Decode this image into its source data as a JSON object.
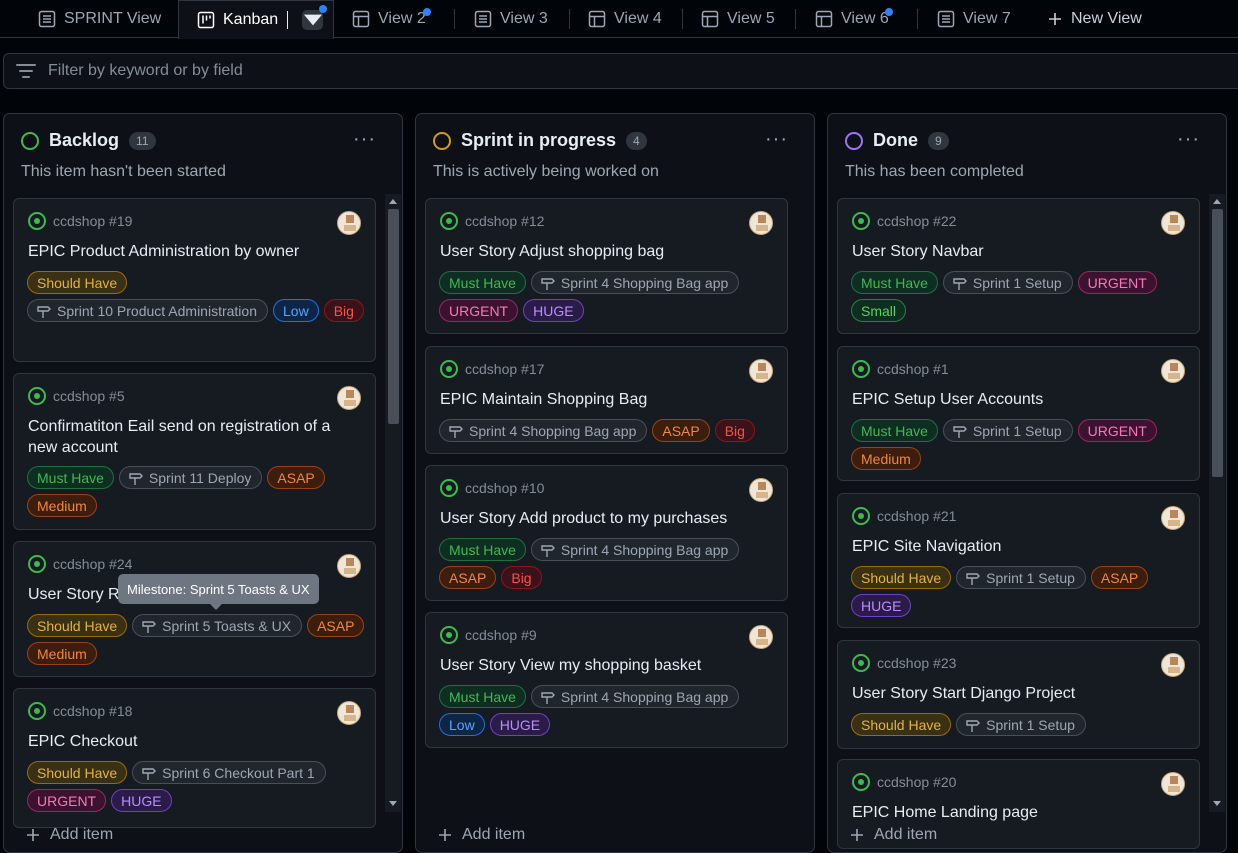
{
  "tabs": [
    {
      "label": "SPRINT View",
      "icon": "table-icon",
      "dot": false
    },
    {
      "label": "Kanban",
      "icon": "board-icon",
      "dot": true
    },
    {
      "label": "View 2",
      "icon": "table-icon",
      "dot": true
    },
    {
      "label": "View 3",
      "icon": "table-icon",
      "dot": false
    },
    {
      "label": "View 4",
      "icon": "table-icon",
      "dot": false
    },
    {
      "label": "View 5",
      "icon": "table-icon",
      "dot": false
    },
    {
      "label": "View 6",
      "icon": "table-icon",
      "dot": true
    },
    {
      "label": "View 7",
      "icon": "table-icon",
      "dot": false
    }
  ],
  "new_view_label": "New View",
  "filter_placeholder": "Filter by keyword or by field",
  "add_item_label": "Add item",
  "tooltip": "Milestone: Sprint 5 Toasts & UX",
  "colors": {
    "green": "#3fb950",
    "orange": "#d29922",
    "purple": "#a371f7"
  },
  "columns": [
    {
      "title": "Backlog",
      "count": "11",
      "desc": "This item hasn't been started",
      "color": "green",
      "cards": [
        {
          "ref": "ccdshop #19",
          "title": "EPIC Product Administration by owner",
          "labels": [
            [
              "Should Have",
              "should"
            ],
            [
              "Sprint 10 Product Administration",
              "ms"
            ],
            [
              "Low",
              "low"
            ],
            [
              "Big",
              "big"
            ]
          ]
        },
        {
          "ref": "ccdshop #5",
          "title": "Confirmatiton Eail send on registration of a new account",
          "labels": [
            [
              "Must Have",
              "must"
            ],
            [
              "Sprint 11 Deploy",
              "ms"
            ],
            [
              "ASAP",
              "asap"
            ],
            [
              "Medium",
              "medium"
            ]
          ]
        },
        {
          "ref": "ccdshop #24",
          "title": "User Story Re",
          "labels": [
            [
              "Should Have",
              "should"
            ],
            [
              "Sprint 5 Toasts & UX",
              "ms"
            ],
            [
              "ASAP",
              "asap"
            ],
            [
              "Medium",
              "medium"
            ]
          ]
        },
        {
          "ref": "ccdshop #18",
          "title": "EPIC Checkout",
          "labels": [
            [
              "Should Have",
              "should"
            ],
            [
              "Sprint 6 Checkout Part 1",
              "ms"
            ],
            [
              "URGENT",
              "urgent"
            ],
            [
              "HUGE",
              "huge"
            ]
          ]
        }
      ]
    },
    {
      "title": "Sprint in progress",
      "count": "4",
      "desc": "This is actively being worked on",
      "color": "orange",
      "cards": [
        {
          "ref": "ccdshop #12",
          "title": "User Story Adjust shopping bag",
          "labels": [
            [
              "Must Have",
              "must"
            ],
            [
              "Sprint 4 Shopping Bag app",
              "ms"
            ],
            [
              "URGENT",
              "urgent"
            ],
            [
              "HUGE",
              "huge"
            ]
          ]
        },
        {
          "ref": "ccdshop #17",
          "title": "EPIC Maintain Shopping Bag",
          "labels": [
            [
              "Sprint 4 Shopping Bag app",
              "ms"
            ],
            [
              "ASAP",
              "asap"
            ],
            [
              "Big",
              "big"
            ]
          ]
        },
        {
          "ref": "ccdshop #10",
          "title": "User Story Add product to my purchases",
          "labels": [
            [
              "Must Have",
              "must"
            ],
            [
              "Sprint 4 Shopping Bag app",
              "ms"
            ],
            [
              "ASAP",
              "asap"
            ],
            [
              "Big",
              "big"
            ]
          ]
        },
        {
          "ref": "ccdshop #9",
          "title": "User Story View my shopping basket",
          "labels": [
            [
              "Must Have",
              "must"
            ],
            [
              "Sprint 4 Shopping Bag app",
              "ms"
            ],
            [
              "Low",
              "low"
            ],
            [
              "HUGE",
              "huge"
            ]
          ]
        }
      ]
    },
    {
      "title": "Done",
      "count": "9",
      "desc": "This has been completed",
      "color": "purple",
      "cards": [
        {
          "ref": "ccdshop #22",
          "title": "User Story Navbar",
          "labels": [
            [
              "Must Have",
              "must"
            ],
            [
              "Sprint 1 Setup",
              "ms"
            ],
            [
              "URGENT",
              "urgent"
            ],
            [
              "Small",
              "small"
            ]
          ]
        },
        {
          "ref": "ccdshop #1",
          "title": "EPIC Setup User Accounts",
          "labels": [
            [
              "Must Have",
              "must"
            ],
            [
              "Sprint 1 Setup",
              "ms"
            ],
            [
              "URGENT",
              "urgent"
            ],
            [
              "Medium",
              "medium"
            ]
          ]
        },
        {
          "ref": "ccdshop #21",
          "title": "EPIC Site Navigation",
          "labels": [
            [
              "Should Have",
              "should"
            ],
            [
              "Sprint 1 Setup",
              "ms"
            ],
            [
              "ASAP",
              "asap"
            ],
            [
              "HUGE",
              "huge"
            ]
          ]
        },
        {
          "ref": "ccdshop #23",
          "title": "User Story Start Django Project",
          "labels": [
            [
              "Should Have",
              "should"
            ],
            [
              "Sprint 1 Setup",
              "ms"
            ]
          ]
        },
        {
          "ref": "ccdshop #20",
          "title": "EPIC Home Landing page",
          "labels": []
        }
      ]
    }
  ]
}
